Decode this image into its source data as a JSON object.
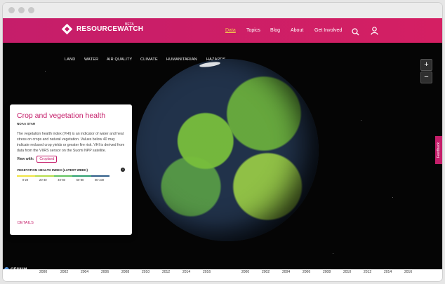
{
  "header": {
    "logo_text": "RESOURCEWATCH",
    "logo_beta": "BETA",
    "nav": [
      "Data",
      "Topics",
      "Blog",
      "About",
      "Get Involved"
    ],
    "search_icon": "search-icon",
    "user_icon": "user-icon"
  },
  "categories": [
    "LAND",
    "WATER",
    "AIR QUALITY",
    "CLIMATE",
    "HUMANITARIAN",
    "HAZARDS"
  ],
  "panel": {
    "title": "Crop and vegetation health",
    "source": "NOAA STAR",
    "description": "The vegetation health index (VHI) is an indicator of water and heat stress on crops and natural vegetation. Values below 40 may indicate reduced crop yields or greater fire risk. VHI is derived from data from the VIIRS sensor on the Suomi NPP satellite.",
    "view_with_label": "View with:",
    "view_with_tag": "Cropland",
    "legend_title": "VEGETATION HEALTH INDEX (LATEST WEEK)",
    "legend_colors": [
      "#f0e442",
      "#b7dd4a",
      "#62c35f",
      "#2c9f6f",
      "#2e5c87"
    ],
    "legend_labels": [
      "0-20",
      "20-40",
      "40-60",
      "60-80",
      "80-100"
    ],
    "details_label": "DETAILS",
    "info_icon": "info-icon"
  },
  "controls": {
    "zoom_in": "+",
    "zoom_out": "−",
    "feedback": "Feedback"
  },
  "cesium_label": "CESIUM",
  "timeline_years": [
    "2000",
    "2002",
    "2004",
    "2006",
    "2008",
    "2010",
    "2012",
    "2014",
    "2016"
  ]
}
